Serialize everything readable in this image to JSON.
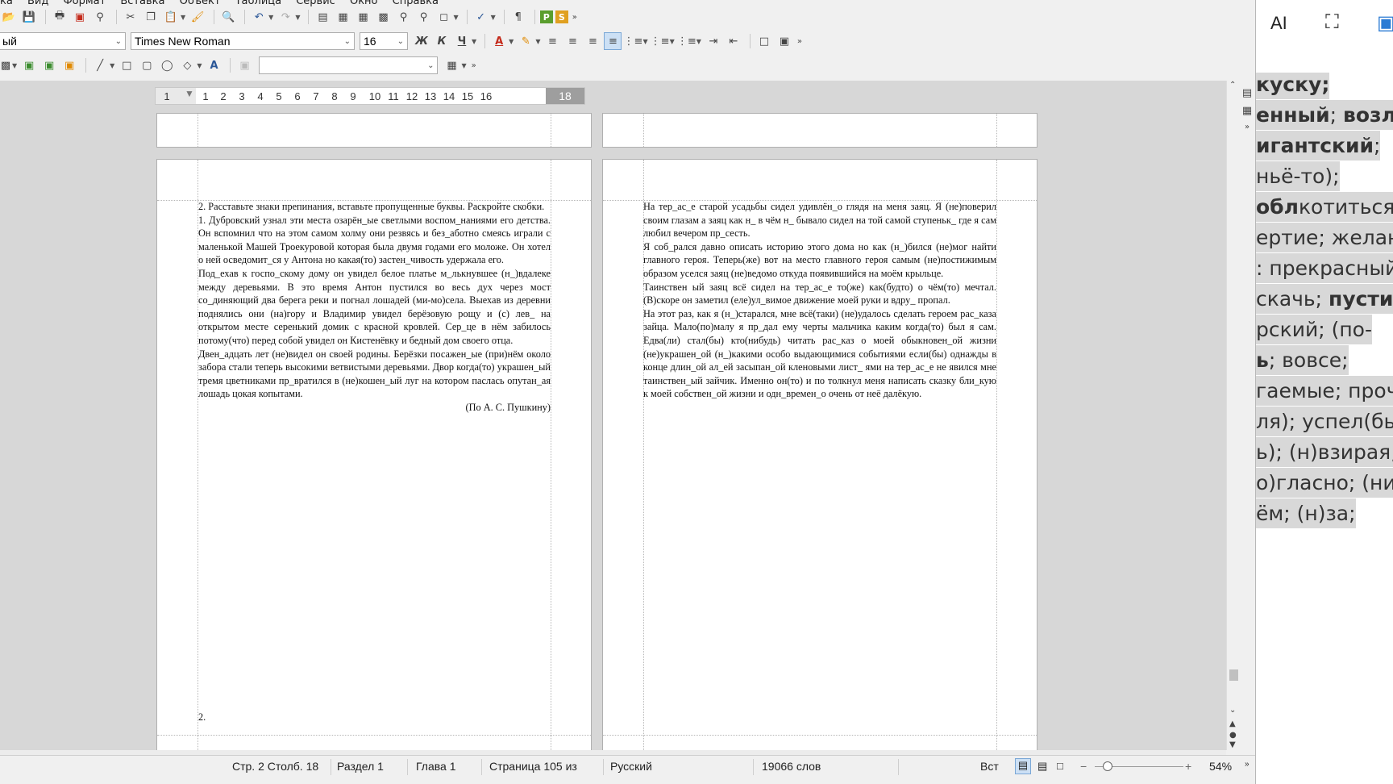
{
  "menu": [
    "ка",
    "Вид",
    "Формат",
    "Вставка",
    "Объект",
    "Таблица",
    "Сервис",
    "Окно",
    "Справка"
  ],
  "toolbar": {
    "style_value": "ый",
    "font_name": "Times New Roman",
    "font_size": "16",
    "bold_label": "Ж",
    "italic_label": "К",
    "underline_label": "Ч"
  },
  "ruler": {
    "numbers": [
      "1",
      "1",
      "2",
      "3",
      "4",
      "5",
      "6",
      "7",
      "8",
      "9",
      "10",
      "11",
      "12",
      "13",
      "14",
      "15",
      "16"
    ],
    "end": "18"
  },
  "page_left": {
    "paragraphs": [
      "2. Расставьте знаки препинания, вставьте пропущенные буквы. Раскройте скобки.",
      "1. Дубровский узнал эти места озарён_ые светлыми воспом_наниями его детства. Он вспомнил что на этом самом холму они резвясь и без_аботно смеясь играли с маленькой Машей Троекуровой которая была двумя годами его моложе. Он хотел о ней осведомит_ся у Антона но какая(то) застен_чивость удержала его.",
      "Под_ехав к госпо_скому дому он увидел белое платье м_лькнувшее (н_)вдалеке между деревьями. В это время Антон пустился во весь дух через мост со_диняющий два берега реки и погнал лошадей (ми-мо)села. Выехав из деревни поднялись они (на)гору и Владимир увидел берёзовую рощу и (с) лев_ на открытом месте серенький домик с красной кровлей. Сер_це в нём забилось потому(что) перед собой увидел он Кистенёвку и бедный дом своего отца.",
      "Двен_адцать лет (не)видел он своей родины. Берёзки посажен_ые (при)нём около забора стали теперь высокими ветвистыми деревьями. Двор когда(то) украшен_ый тремя цветниками пр_вратился в (не)кошен_ый луг на котором паслась опутан_ая лошадь цокая копытами."
    ],
    "attribution": "(По А. С. Пушкину)",
    "footer": "2."
  },
  "page_right": {
    "paragraphs": [
      "На тер_ас_е старой усадьбы сидел удивлён_о глядя на меня заяц. Я (не)поверил своим глазам а заяц как н_ в чём н_ бывало сидел на той самой ступеньк_ где я сам любил вечером пр_сесть.",
      "Я соб_рался давно описать историю этого дома но как (н_)бился (не)мог найти главного героя. Теперь(же) вот на место главного героя самым (не)постижимым образом уселся заяц (не)ведомо откуда появившийся на моём крыльце.",
      "Таинствен ый заяц всё сидел на тер_ас_е то(же) как(будто) о чём(то) мечтал. (В)скоре он заметил (еле)ул_вимое движение моей руки и вдру_ пропал.",
      "На этот раз, как я (н_)старался, мне всё(таки) (не)удалось сделать героем рас_каза зайца. Мало(по)малу я пр_дал ему черты мальчика каким когда(то) был я сам. Едва(ли) стал(бы) кто(нибудь) читать рас_каз о моей обыкновен_ой жизни (не)украшен_ой (н_)какими особо выдающимися событиями если(бы) однажды в конце длин_ой ал_ей засыпан_ой кленовыми лист_ ями на тер_ас_е не явился мне таинствен_ый зайчик. Именно он(то) и по толкнул меня написать сказку бли_кую к моей собствен_ой жизни и одн_времен_о очень от неё далёкую."
    ]
  },
  "status": {
    "page": "Стр. 2 Столб. 18",
    "section": "Раздел 1",
    "chapter": "Глава 1",
    "page_of": "Страница 105 из",
    "language": "Русский",
    "words": "19066 слов",
    "insert_mode": "Вст",
    "zoom": "54%"
  },
  "side_panel": {
    "ai_label": "AI",
    "lines": [
      {
        "pre": "",
        "bold": "куску;",
        "post": ""
      },
      {
        "pre": "",
        "bold": "енный",
        "post": "; ",
        "bold2": "возлага"
      },
      {
        "pre": "",
        "bold": "игантский",
        "post": ";"
      },
      {
        "pre": "",
        "bold": "",
        "post": "ньё-то);"
      },
      {
        "pre": "",
        "bold": "обл",
        "post": "котиться;"
      },
      {
        "pre": "",
        "bold": "",
        "post": "ертие; желанны"
      },
      {
        "pre": "",
        "bold": "",
        "post": ": прекрасный;"
      },
      {
        "pre": "",
        "bold": "",
        "post": "скачь; ",
        "bold2": "пустит"
      },
      {
        "pre": "",
        "bold": "",
        "post": "рский; (по-"
      },
      {
        "pre": "",
        "bold": "ь",
        "post": "; вовсе;"
      },
      {
        "pre": "",
        "bold": "",
        "post": "гаемые; прочь"
      },
      {
        "pre": "",
        "bold": "",
        "post": "ля); успел(бы)"
      },
      {
        "pre": "",
        "bold": "",
        "post": "ь); (н)взирая;"
      },
      {
        "pre": "",
        "bold": "",
        "post": "о)гласно; (ни)с"
      },
      {
        "pre": "",
        "bold": "",
        "post": "ём; (н)за;"
      }
    ]
  }
}
